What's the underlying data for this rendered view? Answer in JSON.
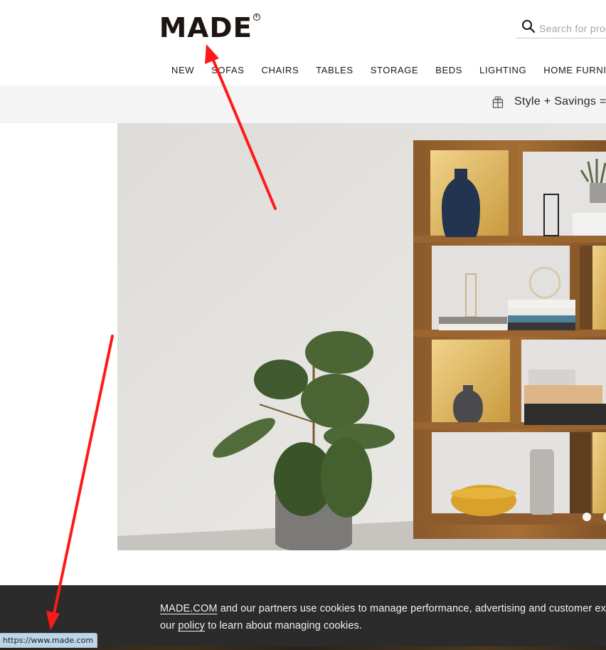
{
  "header": {
    "logo": "MADE",
    "logo_mark": "+",
    "search_placeholder": "Search for products",
    "search_icon": "search-icon"
  },
  "nav": {
    "items": [
      "NEW",
      "SOFAS",
      "CHAIRS",
      "TABLES",
      "STORAGE",
      "BEDS",
      "LIGHTING",
      "HOME FURNISHINGS"
    ]
  },
  "promo": {
    "icon": "gift-icon",
    "text": "Style + Savings ="
  },
  "hero": {
    "description": "Wooden bookcase with mustard-backed compartments styled with vases, books and a fiddle-leaf plant",
    "carousel_dots": 2,
    "active_dot": 1
  },
  "cookie_banner": {
    "link_made": "MADE.COM",
    "text_1": " and our partners use cookies to manage performance, advertising and customer experience. See",
    "text_2_prefix": "our ",
    "link_policy": "policy",
    "text_2_suffix": " to learn about managing cookies."
  },
  "status_bar": {
    "url": "https://www.made.com"
  },
  "colors": {
    "annotation_arrow": "#ff1a1a",
    "cookie_bg": "#2b2b2b",
    "promo_bg": "#f4f4f4",
    "status_bg": "#bcd5e9"
  }
}
